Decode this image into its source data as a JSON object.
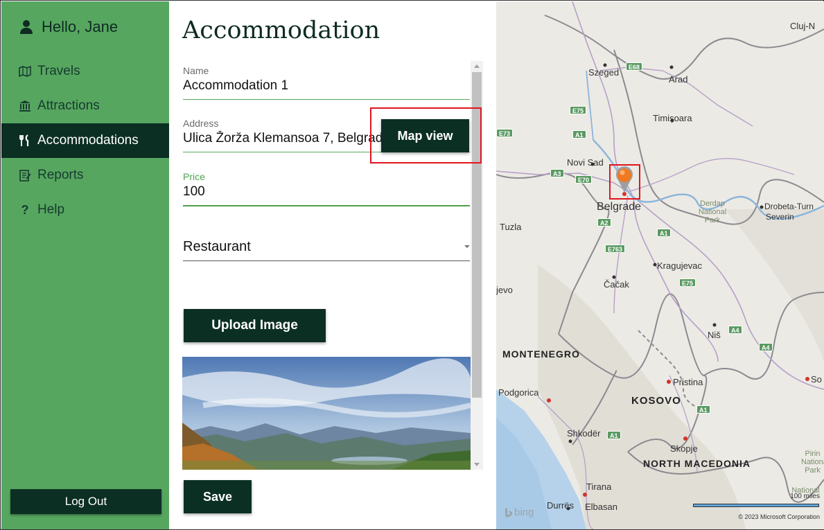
{
  "sidebar": {
    "greeting": "Hello, Jane",
    "items": [
      {
        "label": "Travels",
        "icon": "map-icon"
      },
      {
        "label": "Attractions",
        "icon": "landmark-icon"
      },
      {
        "label": "Accommodations",
        "icon": "utensils-icon"
      },
      {
        "label": "Reports",
        "icon": "report-icon"
      },
      {
        "label": "Help",
        "icon": "question-icon"
      }
    ],
    "active": "Accommodations",
    "logout_label": "Log Out"
  },
  "main": {
    "title": "Accommodation",
    "name_label": "Name",
    "name_value": "Accommodation 1",
    "address_label": "Address",
    "address_value": "Ulica Žorža Klemansoa 7, Belgrade",
    "price_label": "Price",
    "price_value": "100",
    "type_selected": "Restaurant",
    "upload_label": "Upload Image",
    "map_view_label": "Map view",
    "save_label": "Save"
  },
  "map": {
    "cities": [
      "Cluj-N",
      "Szeged",
      "Arad",
      "Timișoara",
      "Novi Sad",
      "Belgrade",
      "Drobeta-Turn",
      "Severin",
      "Tuzla",
      "Kragujevac",
      "Čačak",
      "jevo",
      "Niš",
      "Podgorica",
      "Pristina",
      "So",
      "Shkodër",
      "Skopje",
      "Tirana",
      "Durrës",
      "Elbasan"
    ],
    "countries": [
      "MONTENEGRO",
      "KOSOVO",
      "NORTH MACEDONIA"
    ],
    "parks": [
      "Derdap National Park",
      "Pirin Nationa Park",
      "National"
    ],
    "shields": [
      "E68",
      "E75",
      "E73",
      "A1",
      "A3",
      "E70",
      "A2",
      "A1",
      "E763",
      "E75",
      "A4",
      "A4",
      "A1",
      "A1"
    ],
    "scale_label": "100 miles",
    "copyright": "© 2023 Microsoft Corporation",
    "brand": "bing",
    "accent": "#57a660",
    "dark": "#0c2f24"
  }
}
